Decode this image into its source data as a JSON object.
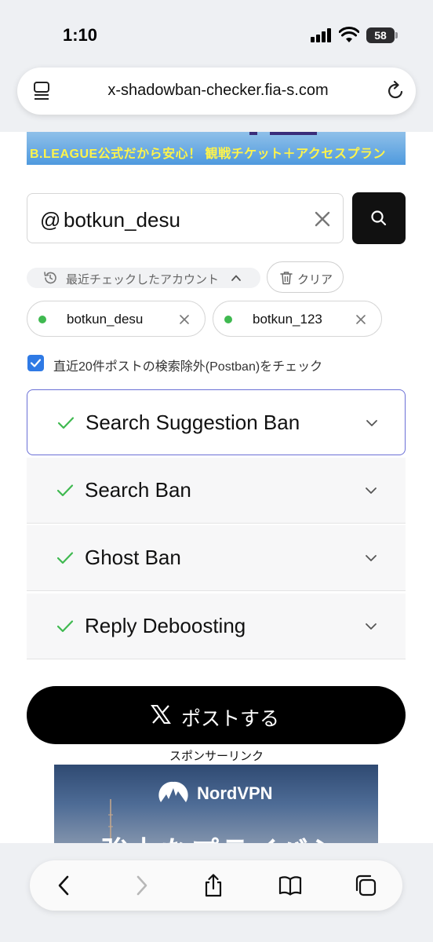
{
  "status_bar": {
    "time": "1:10",
    "battery": "58"
  },
  "browser": {
    "url": "x-shadowban-checker.fia-s.com"
  },
  "banner": {
    "text": "B.LEAGUE公式だから安心！ 観戦チケット＋アクセスプラン"
  },
  "search": {
    "prefix": "@",
    "value": "botkun_desu"
  },
  "history": {
    "label": "最近チェックしたアカウント",
    "clear_label": "クリア",
    "accounts": [
      {
        "name": "botkun_desu",
        "status_color": "#3fb950"
      },
      {
        "name": "botkun_123",
        "status_color": "#3fb950"
      }
    ]
  },
  "postban_option": {
    "label": "直近20件ポストの検索除外(Postban)をチェック",
    "checked": true
  },
  "checks": [
    {
      "title": "Search Suggestion Ban",
      "result": "ok"
    },
    {
      "title": "Search Ban",
      "result": "ok"
    },
    {
      "title": "Ghost Ban",
      "result": "ok"
    },
    {
      "title": "Reply Deboosting",
      "result": "ok"
    }
  ],
  "post_button": {
    "label": "ポストする"
  },
  "sponsor": {
    "label": "スポンサーリンク",
    "ad_brand": "NordVPN",
    "ad_headline": "強力なプライバシー"
  },
  "colors": {
    "accent": "#6a6fd6",
    "ok": "#3fb950",
    "checkbox": "#2f7ae5"
  }
}
